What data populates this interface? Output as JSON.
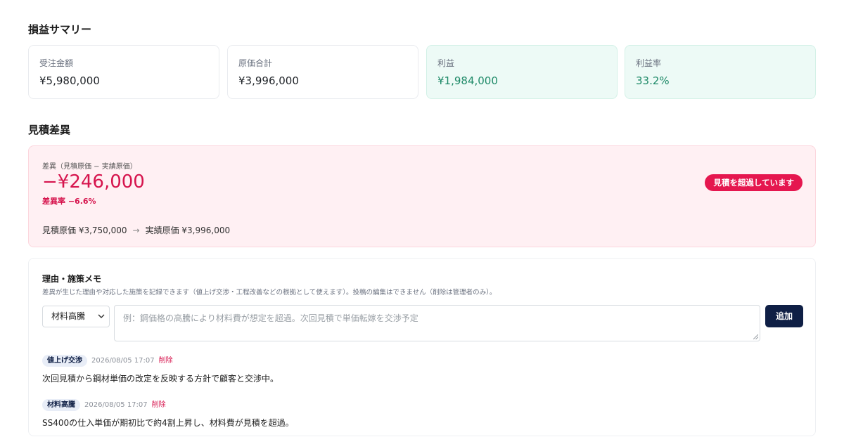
{
  "summary": {
    "title": "損益サマリー",
    "cards": [
      {
        "label": "受注金額",
        "value": "¥5,980,000"
      },
      {
        "label": "原価合計",
        "value": "¥3,996,000"
      },
      {
        "label": "利益",
        "value": "¥1,984,000"
      },
      {
        "label": "利益率",
        "value": "33.2%"
      }
    ]
  },
  "variance": {
    "title": "見積差異",
    "subtitle": "差異（見積原価 − 実績原価）",
    "amount": "−¥246,000",
    "rate": "差異率 −6.6%",
    "badge": "見積を超過しています",
    "estimate": "見積原価 ¥3,750,000",
    "arrow": "→",
    "actual": "実績原価 ¥3,996,000"
  },
  "memo": {
    "title": "理由・施策メモ",
    "description": "差異が生じた理由や対応した施策を記録できます（値上げ交渉・工程改善などの根拠として使えます）。投稿の編集はできません（削除は管理者のみ）。",
    "select_value": "材料高騰",
    "placeholder": "例：鋼価格の高騰により材料費が想定を超過。次回見積で単価転嫁を交渉予定",
    "add_label": "追加",
    "entries": [
      {
        "tag": "値上げ交渉",
        "timestamp": "2026/08/05 17:07",
        "delete_label": "削除",
        "body": "次回見積から鋼材単価の改定を反映する方針で顧客と交渉中。"
      },
      {
        "tag": "材料高騰",
        "timestamp": "2026/08/05 17:07",
        "delete_label": "削除",
        "body": "SS400の仕入単価が期初比で約4割上昇し、材料費が見積を超過。"
      }
    ]
  },
  "colors": {
    "accent_navy": "#0f1f45",
    "profit_green": "#1f8a68",
    "variance_red": "#d6144d"
  }
}
